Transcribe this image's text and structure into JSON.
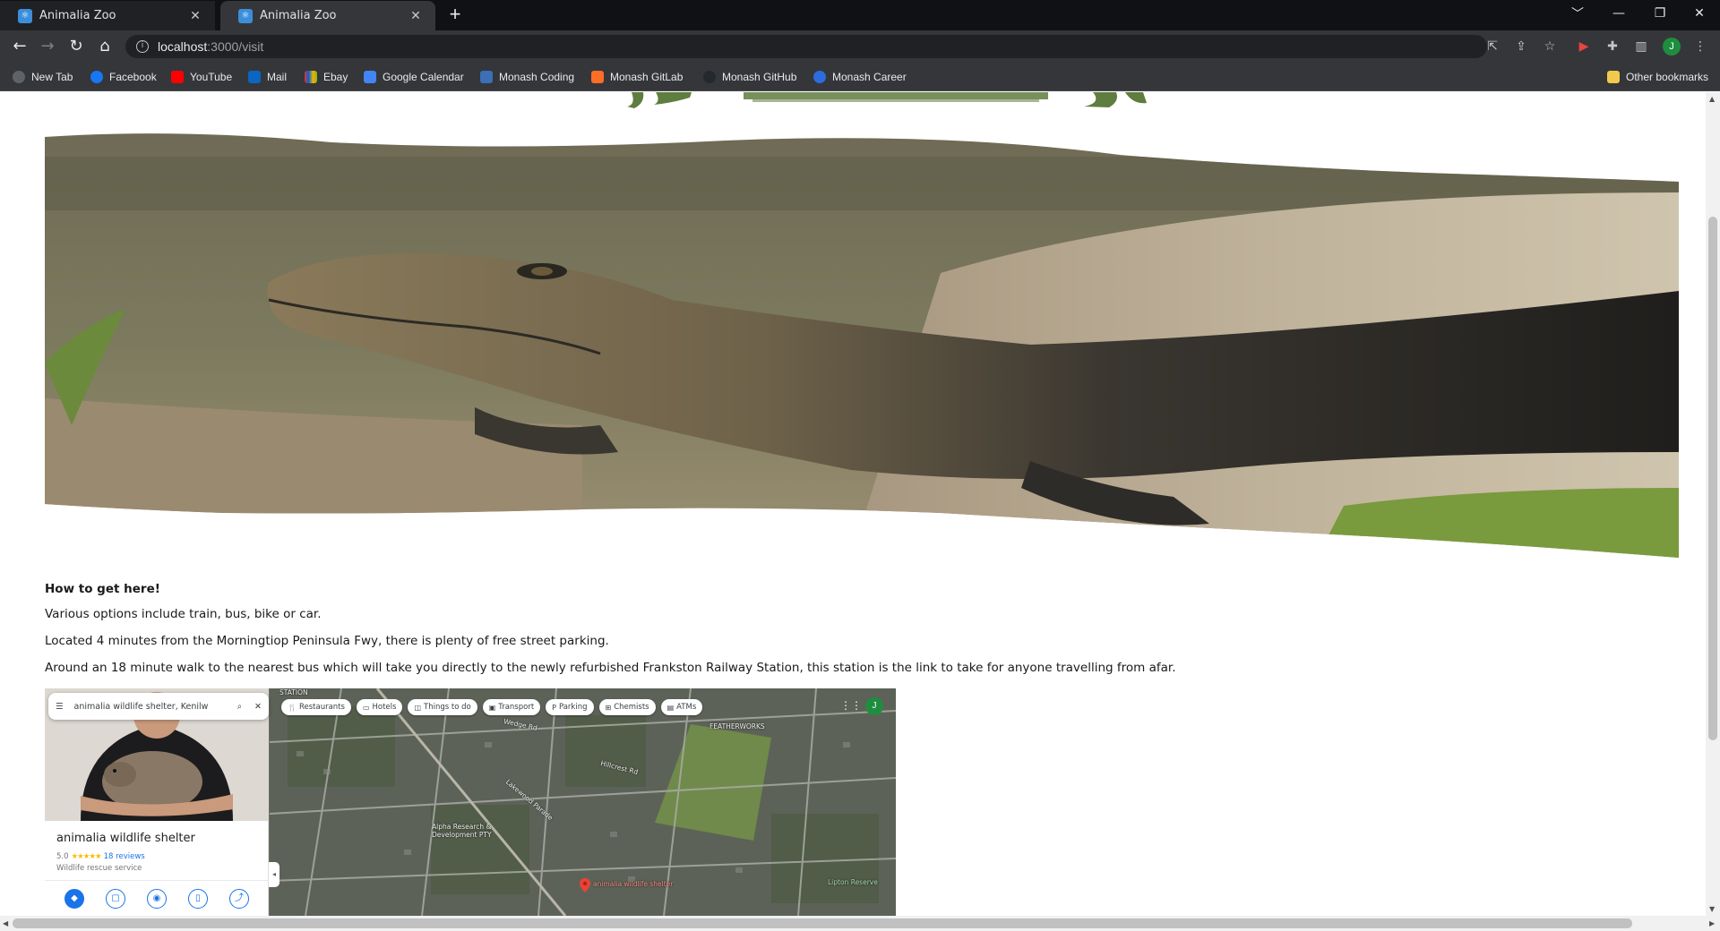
{
  "browser": {
    "tabs": [
      {
        "title": "Animalia Zoo",
        "active": false
      },
      {
        "title": "Animalia Zoo",
        "active": true
      }
    ],
    "new_tab": "+",
    "url_host": "localhost",
    "url_path": ":3000/visit",
    "window_controls": [
      "﹀",
      "—",
      "❐",
      "✕"
    ],
    "bookmarks": [
      {
        "label": "New Tab",
        "color": "#5f6368"
      },
      {
        "label": "Facebook",
        "color": "#1877f2"
      },
      {
        "label": "YouTube",
        "color": "#ff0000"
      },
      {
        "label": "Mail",
        "color": "#0a66c2"
      },
      {
        "label": "Ebay",
        "color": "#e53238"
      },
      {
        "label": "Google Calendar",
        "color": "#4285f4"
      },
      {
        "label": "Monash Coding",
        "color": "#3b6fb6"
      },
      {
        "label": "Monash  GitLab",
        "color": "#fc6d26"
      },
      {
        "label": "Monash GitHub",
        "color": "#24292e"
      },
      {
        "label": "Monash Career",
        "color": "#2d6cdf"
      }
    ],
    "other_bookmarks": "Other bookmarks",
    "profile_initial": "J"
  },
  "page": {
    "heading": "How to get here!",
    "paragraphs": [
      "Various options include train, bus, bike or car.",
      "Located 4 minutes from the Morningtiop Peninsula Fwy, there is plenty of free street parking.",
      "Around an 18 minute walk to the nearest bus which will take you directly to the newly refurbished Frankston Railway Station, this station is the link to take for anyone travelling from afar."
    ]
  },
  "map": {
    "search_value": "animalia wildlife shelter, Kenilw",
    "place_name": "animalia wildlife shelter",
    "rating": "5.0",
    "stars": "★★★★★",
    "reviews": "18 reviews",
    "place_type": "Wildlife rescue service",
    "chips": [
      {
        "icon": "🍴",
        "label": "Restaurants"
      },
      {
        "icon": "▭",
        "label": "Hotels"
      },
      {
        "icon": "◫",
        "label": "Things to do"
      },
      {
        "icon": "▣",
        "label": "Transport"
      },
      {
        "icon": "P",
        "label": "Parking"
      },
      {
        "icon": "⊞",
        "label": "Chemists"
      },
      {
        "icon": "▤",
        "label": "ATMs"
      }
    ],
    "labels": {
      "featherworks": "FEATHERWORKS",
      "alpha": "Alpha Research &",
      "alpha2": "Development PTY",
      "pin_label": "animalia wildlife shelter",
      "lipton": "Lipton Reserve",
      "station": "STATION",
      "road1": "Wedge Rd",
      "road2": "Hillcrest Rd",
      "road3": "Lakewood Parade"
    },
    "avatar": "J"
  },
  "colors": {
    "accent": "#1a73e8",
    "chrome_dark": "#202124",
    "logo_green": "#5f7d3e"
  }
}
